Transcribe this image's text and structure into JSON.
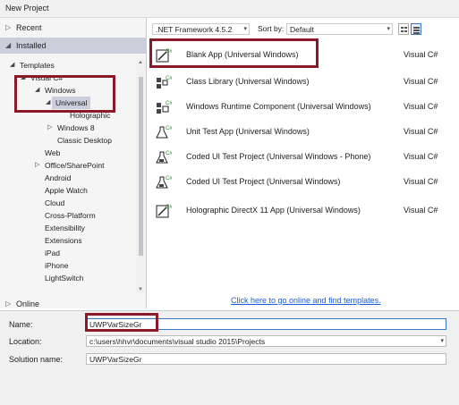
{
  "window": {
    "title": "New Project"
  },
  "left": {
    "recent_label": "Recent",
    "installed_label": "Installed",
    "online_label": "Online",
    "tree": [
      {
        "label": "Templates",
        "expanded": true
      },
      {
        "label": "Visual C#",
        "expanded": true
      },
      {
        "label": "Windows",
        "expanded": true
      },
      {
        "label": "Universal",
        "expanded": true,
        "selected": true
      },
      {
        "label": "Holographic"
      },
      {
        "label": "Windows 8",
        "expanded": false
      },
      {
        "label": "Classic Desktop"
      },
      {
        "label": "Web"
      },
      {
        "label": "Office/SharePoint",
        "expanded": false
      },
      {
        "label": "Android"
      },
      {
        "label": "Apple Watch"
      },
      {
        "label": "Cloud"
      },
      {
        "label": "Cross-Platform"
      },
      {
        "label": "Extensibility"
      },
      {
        "label": "Extensions"
      },
      {
        "label": "iPad"
      },
      {
        "label": "iPhone"
      },
      {
        "label": "LightSwitch"
      }
    ]
  },
  "toolbar": {
    "framework": ".NET Framework 4.5.2",
    "sort_label": "Sort by:",
    "sort_value": "Default"
  },
  "templates": [
    {
      "name": "Blank App (Universal Windows)",
      "lang": "Visual C#",
      "icon": "blank-app-icon"
    },
    {
      "name": "Class Library (Universal Windows)",
      "lang": "Visual C#",
      "icon": "class-library-icon"
    },
    {
      "name": "Windows Runtime Component (Universal Windows)",
      "lang": "Visual C#",
      "icon": "runtime-component-icon"
    },
    {
      "name": "Unit Test App (Universal Windows)",
      "lang": "Visual C#",
      "icon": "unit-test-icon"
    },
    {
      "name": "Coded UI Test Project (Universal Windows - Phone)",
      "lang": "Visual C#",
      "icon": "coded-ui-test-icon"
    },
    {
      "name": "Coded UI Test Project (Universal Windows)",
      "lang": "Visual C#",
      "icon": "coded-ui-test-icon"
    },
    {
      "name": "Holographic DirectX 11 App (Universal Windows)",
      "lang": "Visual C#",
      "icon": "holographic-app-icon"
    }
  ],
  "online_link": "Click here to go online and find templates.",
  "form": {
    "name_label": "Name:",
    "name_value": "UWPVarSizeGr",
    "location_label": "Location:",
    "location_value": "c:\\users\\hhvr\\documents\\visual studio 2015\\Projects",
    "solution_label": "Solution name:",
    "solution_value": "UWPVarSizeGr"
  },
  "colors": {
    "highlight_border": "#8a1a2a",
    "selection": "#cccedb",
    "link": "#1a5bd6"
  }
}
